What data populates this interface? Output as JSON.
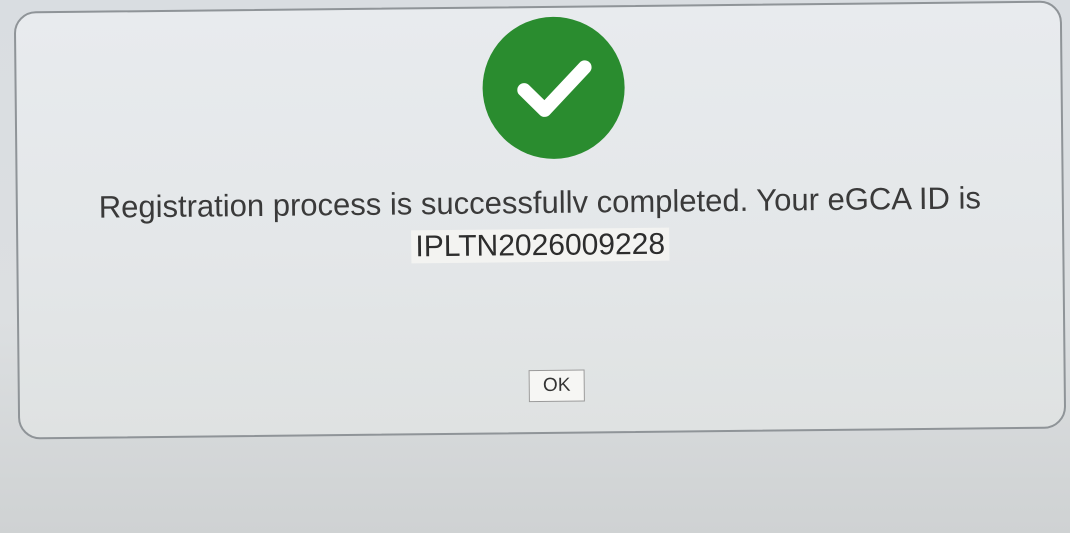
{
  "dialog": {
    "status_icon": "check-circle-icon",
    "message": "Registration process is successfullv completed. Your eGCA ID is",
    "egca_id": "IPLTN2026009228",
    "ok_label": "OK"
  },
  "colors": {
    "success_green": "#2a8c2f",
    "dialog_border": "#8f9498",
    "background": "#dcdfe1"
  }
}
